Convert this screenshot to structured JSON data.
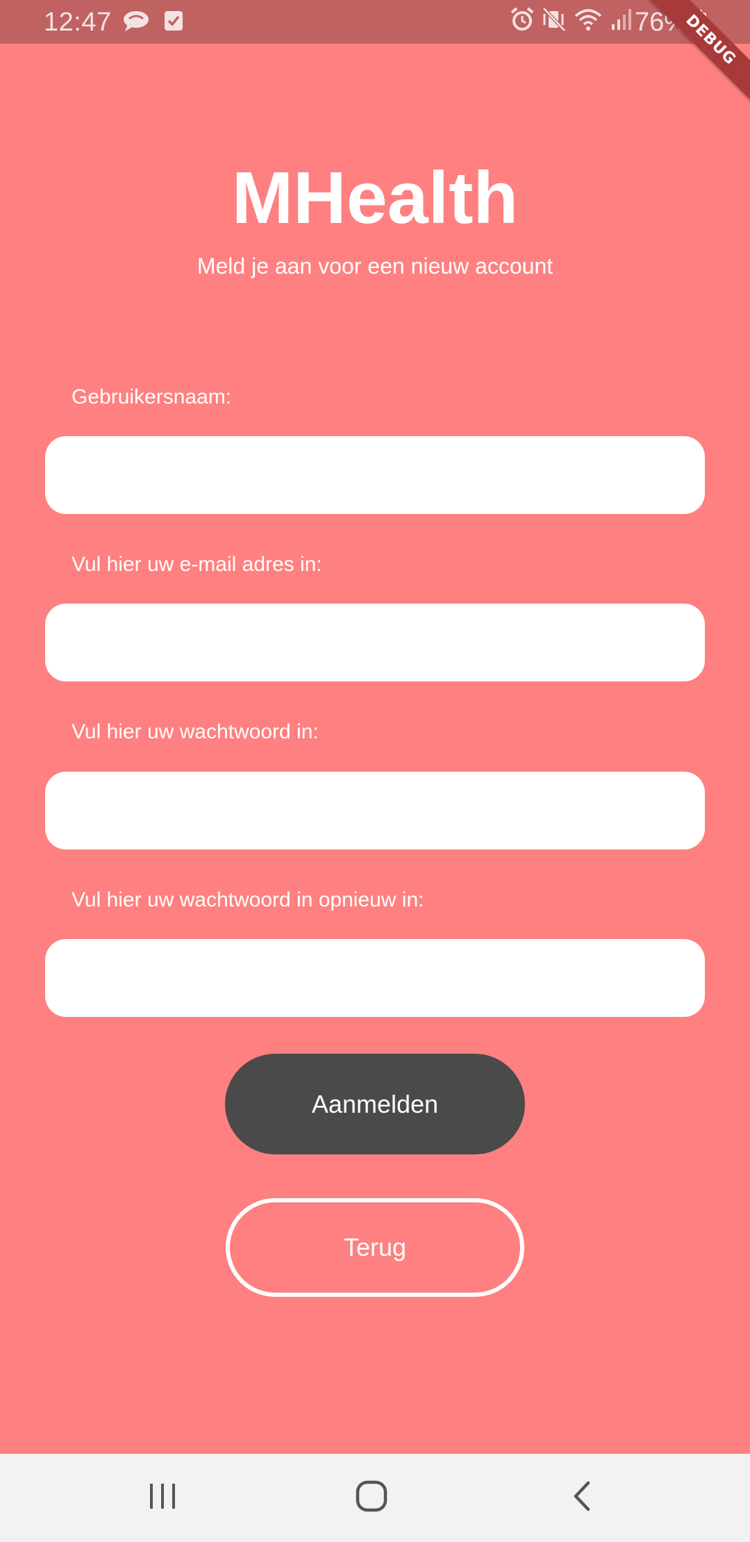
{
  "status_bar": {
    "time": "12:47",
    "battery": "76%",
    "left_icons": [
      "messaging-icon",
      "task-check-icon"
    ],
    "right_icons": [
      "alarm-icon",
      "mute-vibrate-icon",
      "wifi-icon",
      "signal-icon",
      "battery-charging-icon"
    ]
  },
  "debug_banner": "DEBUG",
  "header": {
    "title": "MHealth",
    "subtitle": "Meld je aan voor een nieuw account"
  },
  "form": {
    "username": {
      "label": "Gebruikersnaam:",
      "value": ""
    },
    "email": {
      "label": "Vul hier uw e-mail adres in:",
      "value": ""
    },
    "password": {
      "label": "Vul hier uw wachtwoord in:",
      "value": ""
    },
    "password_confirm": {
      "label": "Vul hier uw wachtwoord in opnieuw in:",
      "value": ""
    }
  },
  "buttons": {
    "register": "Aanmelden",
    "back": "Terug"
  },
  "nav_bar": {
    "icons": [
      "recent-apps-icon",
      "home-icon",
      "back-icon"
    ]
  },
  "colors": {
    "background": "#ff8080",
    "status_bar": "#c06262",
    "primary_button": "#4a4a4a",
    "debug_ribbon": "#a83a3a",
    "nav_bar": "#f2f2f2"
  }
}
